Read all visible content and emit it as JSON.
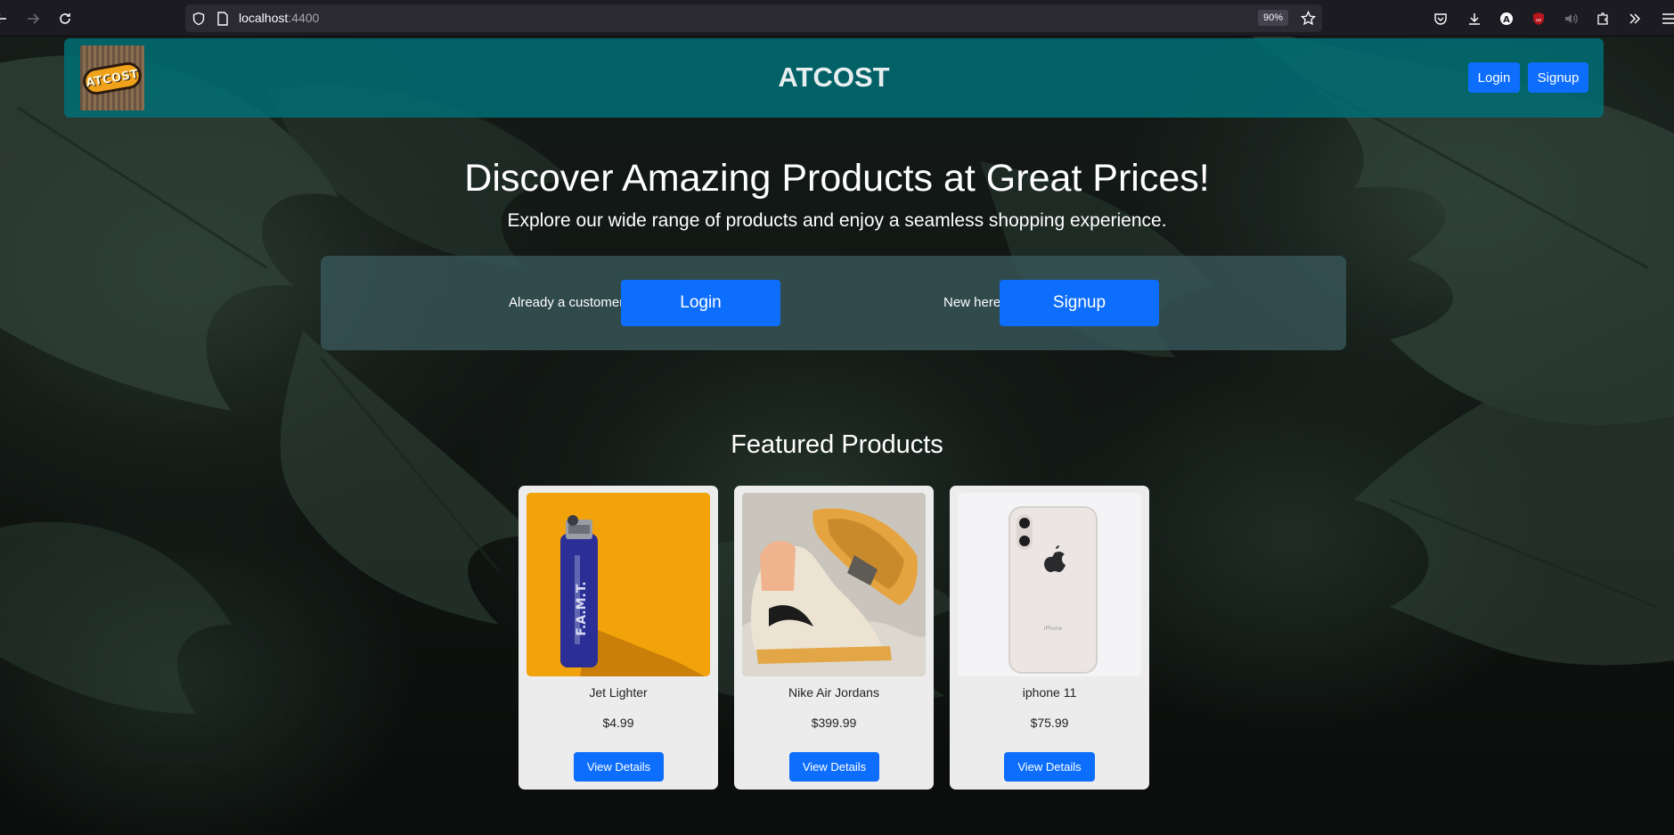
{
  "browser": {
    "url_host": "localhost",
    "url_port": ":4400",
    "zoom": "90%"
  },
  "navbar": {
    "logo_text": "ATCOST",
    "brand": "ATCOST",
    "login_label": "Login",
    "signup_label": "Signup"
  },
  "hero": {
    "title": "Discover Amazing Products at Great Prices!",
    "subtitle": "Explore our wide range of products and enjoy a seamless shopping experience.",
    "customer_label": "Already a customer",
    "login_label": "Login",
    "new_label": "New here",
    "signup_label": "Signup"
  },
  "featured": {
    "title": "Featured Products",
    "products": [
      {
        "name": "Jet Lighter",
        "price": "$4.99",
        "button": "View Details",
        "image": "blue-lighter-on-orange"
      },
      {
        "name": "Nike Air Jordans",
        "price": "$399.99",
        "button": "View Details",
        "image": "sneakers"
      },
      {
        "name": "iphone 11",
        "price": "$75.99",
        "button": "View Details",
        "image": "white-iphone"
      }
    ]
  },
  "colors": {
    "primary_button": "#0d6efd",
    "navbar_teal": "#006e73",
    "card_bg": "#ececec"
  }
}
